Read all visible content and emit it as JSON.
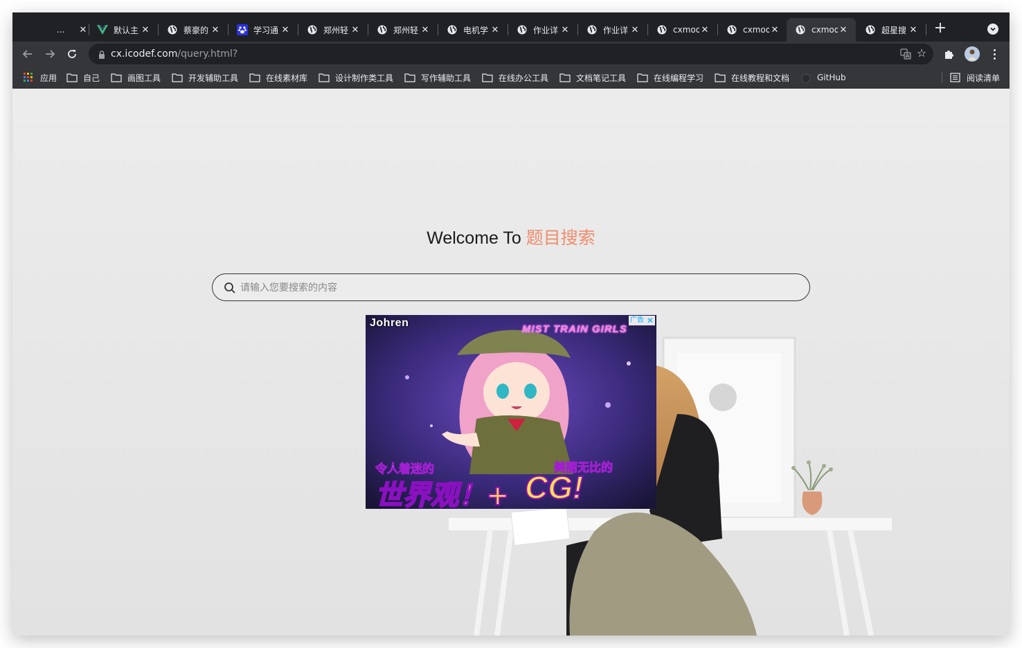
{
  "browser": {
    "tabs": [
      {
        "title": "...",
        "icon": "blank-icon",
        "active": false
      },
      {
        "title": "默认主",
        "icon": "vue-icon",
        "active": false
      },
      {
        "title": "蔡豪的",
        "icon": "globe-icon",
        "active": false
      },
      {
        "title": "学习通",
        "icon": "paw-icon",
        "active": false
      },
      {
        "title": "郑州轻",
        "icon": "globe-icon",
        "active": false
      },
      {
        "title": "郑州轻",
        "icon": "globe-icon",
        "active": false
      },
      {
        "title": "电机学",
        "icon": "globe-icon",
        "active": false
      },
      {
        "title": "作业详",
        "icon": "globe-icon",
        "active": false
      },
      {
        "title": "作业详",
        "icon": "globe-icon",
        "active": false
      },
      {
        "title": "cxmoo",
        "icon": "globe-icon",
        "active": false
      },
      {
        "title": "cxmoo",
        "icon": "globe-icon",
        "active": false
      },
      {
        "title": "cxmoo",
        "icon": "globe-icon",
        "active": true
      },
      {
        "title": "超星搜",
        "icon": "globe-icon",
        "active": false
      }
    ],
    "close_glyph": "✕",
    "new_tab_glyph": "+",
    "url_host": "cx.icodef.com",
    "url_path": "/query.html?",
    "bookmarks": [
      {
        "label": "应用",
        "icon": "apps-grid-icon"
      },
      {
        "label": "自己",
        "icon": "folder-icon"
      },
      {
        "label": "画图工具",
        "icon": "folder-icon"
      },
      {
        "label": "开发辅助工具",
        "icon": "folder-icon"
      },
      {
        "label": "在线素材库",
        "icon": "folder-icon"
      },
      {
        "label": "设计制作类工具",
        "icon": "folder-icon"
      },
      {
        "label": "写作辅助工具",
        "icon": "folder-icon"
      },
      {
        "label": "在线办公工具",
        "icon": "folder-icon"
      },
      {
        "label": "文档笔记工具",
        "icon": "folder-icon"
      },
      {
        "label": "在线编程学习",
        "icon": "folder-icon"
      },
      {
        "label": "在线教程和文档",
        "icon": "folder-icon"
      },
      {
        "label": "GitHub",
        "icon": "github-icon"
      }
    ],
    "reading_list": "阅读清单"
  },
  "page": {
    "welcome_prefix": "Welcome To",
    "welcome_accent": "题目搜索",
    "search_placeholder": "请输入您要搜索的内容",
    "accent_color": "#f08d6e"
  },
  "ad": {
    "brand": "Johren",
    "game_title": "MIST TRAIN GIRLS",
    "label": "广告",
    "close_glyph": "✕",
    "tagline_left_small": "令人着迷的",
    "tagline_left_big": "世界观！+",
    "tagline_right_small": "美丽无比的",
    "tagline_right_big": "CG!"
  }
}
